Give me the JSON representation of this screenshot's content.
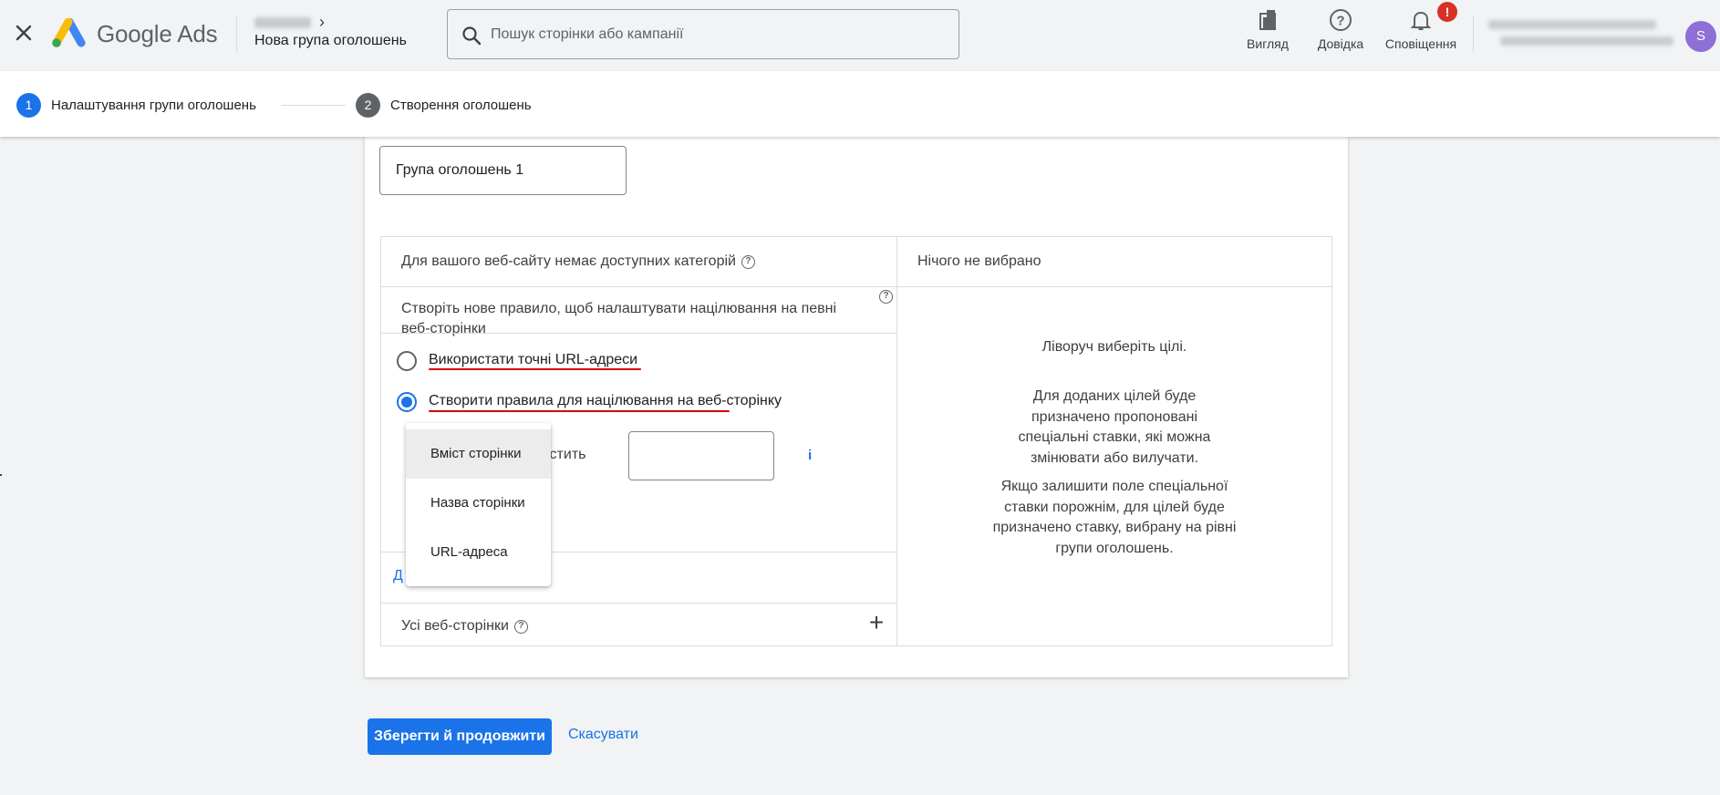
{
  "header": {
    "logo_text": "Google Ads",
    "breadcrumb_title": "Нова група оголошень",
    "search_placeholder": "Пошук сторінки або кампанії",
    "tools": [
      {
        "label": "Вигляд",
        "icon": "appearance-icon"
      },
      {
        "label": "Довідка",
        "icon": "help-icon"
      },
      {
        "label": "Сповіщення",
        "icon": "bell-icon",
        "badge": "!"
      }
    ],
    "avatar_letter": "S"
  },
  "stepper": {
    "steps": [
      {
        "number": "1",
        "label": "Налаштування групи оголошень",
        "state": "active"
      },
      {
        "number": "2",
        "label": "Створення оголошень",
        "state": "inactive"
      }
    ]
  },
  "form": {
    "ad_group_name": "Група оголошень 1",
    "left_header": "Для вашого веб-сайту немає доступних категорій",
    "rule_description": "Створіть нове правило, щоб налаштувати націлювання на певні веб-сторінки",
    "radio_options": [
      {
        "label": "Використати точні URL-адреси",
        "checked": false
      },
      {
        "label": "Створити правила для націлювання на веб-сторінку",
        "checked": true
      }
    ],
    "contains_text": "містить",
    "info_link": "i",
    "add_link": "Д",
    "all_pages_label": "Усі веб-сторінки",
    "right_header": "Нічого не вибрано",
    "right_messages": [
      "Ліворуч виберіть цілі.",
      "Для доданих цілей буде призначено пропоновані спеціальні ставки, які можна змінювати або вилучати.",
      "Якщо залишити поле спеціальної ставки порожнім, для цілей буде призначено ставку, вибрану на рівні групи оголошень."
    ]
  },
  "dropdown": {
    "items": [
      "Вміст сторінки",
      "Назва сторінки",
      "URL-адреса"
    ],
    "selected_index": 0
  },
  "actions": {
    "save_label": "Зберегти й продовжити",
    "cancel_label": "Скасувати"
  },
  "colors": {
    "primary": "#1a73e8",
    "annotation_underline": "#d50000",
    "notification_badge": "#d93025"
  }
}
